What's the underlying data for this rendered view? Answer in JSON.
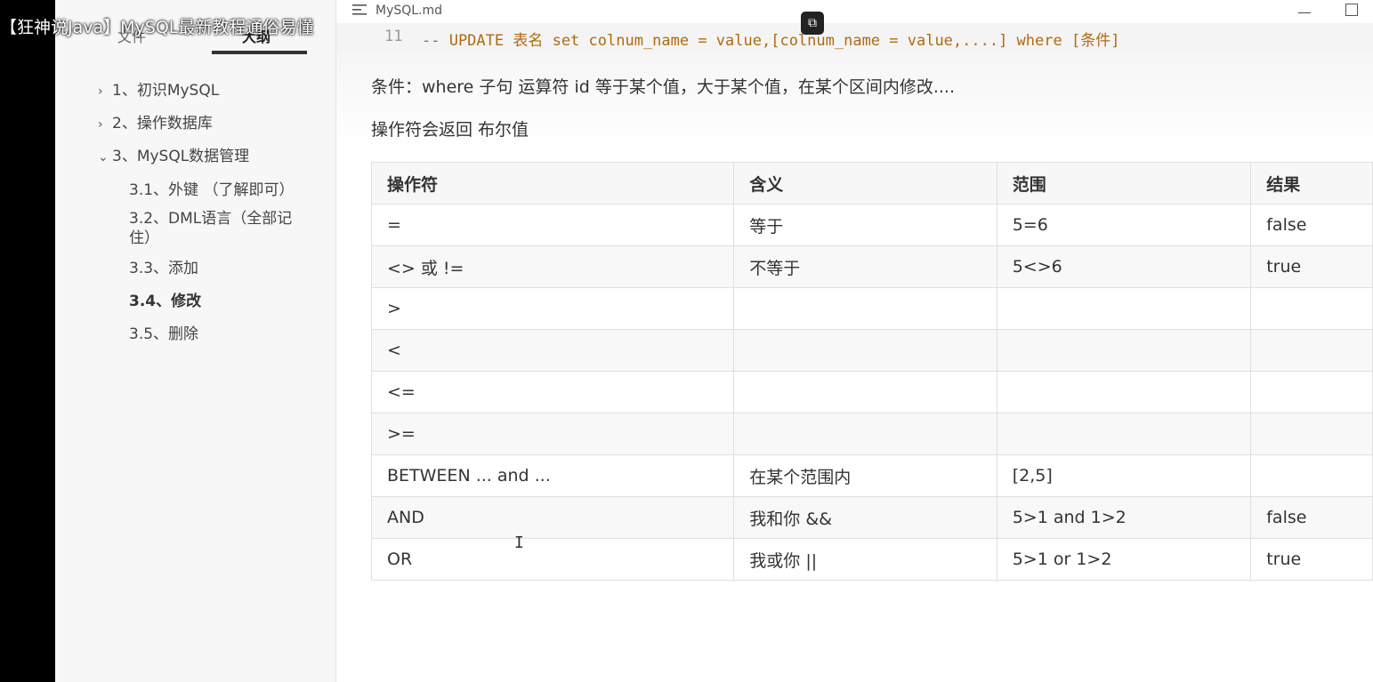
{
  "video_title": "【狂神说Java】MySQL最新教程通俗易懂",
  "sidebar": {
    "tabs": [
      "文件",
      "大纲"
    ],
    "items": [
      {
        "label": "1、初识MySQL",
        "chev": "›"
      },
      {
        "label": "2、操作数据库",
        "chev": "›"
      },
      {
        "label": "3、MySQL数据管理",
        "chev": "⌄"
      },
      {
        "label": "3.1、外键 （了解即可）"
      },
      {
        "label": "3.2、DML语言（全部记住）"
      },
      {
        "label": "3.3、添加"
      },
      {
        "label": "3.4、修改"
      },
      {
        "label": "3.5、删除"
      }
    ]
  },
  "editor": {
    "doc_title": "MySQL.md",
    "code_line_number": "11",
    "code_text": "-- UPDATE 表名 set colnum_name = value,[colnum_name = value,....] where [条件]",
    "para1": "条件：where 子句 运算符  id 等于某个值，大于某个值，在某个区间内修改....",
    "para2": "操作符会返回 布尔值"
  },
  "table": {
    "headers": [
      "操作符",
      "含义",
      "范围",
      "结果"
    ],
    "rows": [
      [
        "=",
        "等于",
        " 5=6",
        "false"
      ],
      [
        "<> 或 !=",
        "不等于",
        "5<>6",
        "true"
      ],
      [
        ">",
        "",
        "",
        ""
      ],
      [
        "<",
        "",
        "",
        ""
      ],
      [
        "<=",
        "",
        "",
        ""
      ],
      [
        ">=",
        "",
        "",
        ""
      ],
      [
        "BETWEEN ...  and ...",
        "在某个范围内",
        "[2,5]",
        ""
      ],
      [
        "AND",
        "我和你 &&",
        "5>1 and 1>2",
        "false"
      ],
      [
        "OR",
        "我或你 ||",
        "5>1 or  1>2",
        "true"
      ]
    ]
  },
  "icons": [
    "menu-icon",
    "minimize-icon",
    "maximize-icon",
    "pip-icon",
    "ibeam-cursor-icon"
  ]
}
